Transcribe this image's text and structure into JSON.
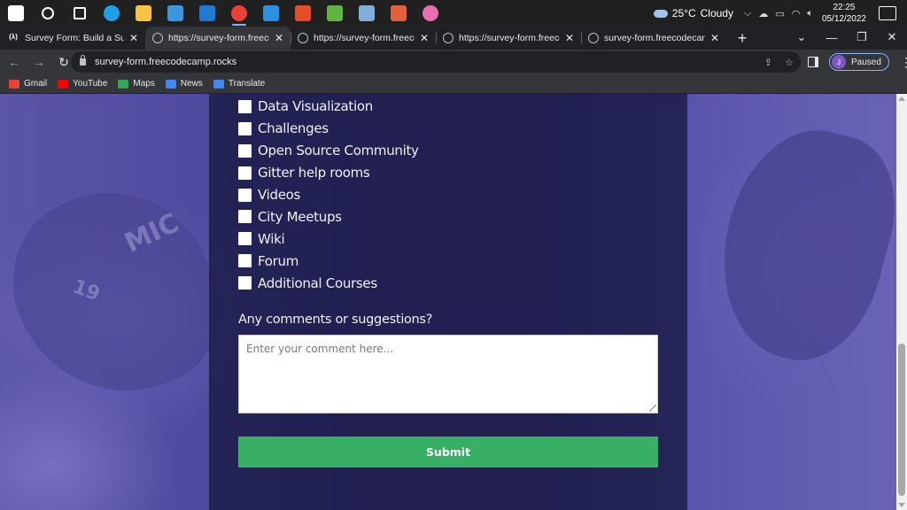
{
  "taskbar": {
    "icons": [
      {
        "name": "windows-start-icon",
        "color": "#ffffff"
      },
      {
        "name": "search-icon",
        "color": "#ffffff"
      },
      {
        "name": "task-view-icon",
        "color": "#ffffff"
      },
      {
        "name": "edge-icon",
        "color": "#1fa0e8"
      },
      {
        "name": "file-explorer-icon",
        "color": "#f6c343"
      },
      {
        "name": "microsoft-store-icon",
        "color": "#3a96dd"
      },
      {
        "name": "mail-icon",
        "color": "#1f7ad6"
      },
      {
        "name": "chrome-icon",
        "color": "#e94235"
      },
      {
        "name": "vscode-icon",
        "color": "#2d8fe0"
      },
      {
        "name": "office-icon",
        "color": "#e44c2a"
      },
      {
        "name": "green-app-icon",
        "color": "#5fb53f"
      },
      {
        "name": "notepad-icon",
        "color": "#7fb0d9"
      },
      {
        "name": "paint-3d-icon",
        "color": "#e2603b"
      },
      {
        "name": "itunes-icon",
        "color": "#e96db0"
      }
    ],
    "weather": {
      "temp": "25°C",
      "condition": "Cloudy"
    },
    "clock": {
      "time": "22:25",
      "date": "05/12/2022"
    }
  },
  "tabs": [
    {
      "title": "Survey Form: Build a Survey F",
      "favicon": "fcc"
    },
    {
      "title": "https://survey-form.freecode",
      "favicon": "globe",
      "active": true
    },
    {
      "title": "https://survey-form.freecode",
      "favicon": "globe"
    },
    {
      "title": "https://survey-form.freecode",
      "favicon": "globe"
    },
    {
      "title": "survey-form.freecodecamp.ro",
      "favicon": "globe"
    }
  ],
  "address_bar": {
    "url": "survey-form.freecodecamp.rocks"
  },
  "profile": {
    "initial": "J",
    "status": "Paused"
  },
  "bookmarks": [
    {
      "label": "Gmail",
      "color": "#ea4335"
    },
    {
      "label": "YouTube",
      "color": "#ff0000"
    },
    {
      "label": "Maps",
      "color": "#34a853"
    },
    {
      "label": "News",
      "color": "#4285f4"
    },
    {
      "label": "Translate",
      "color": "#4285f4"
    }
  ],
  "form": {
    "checkboxes": [
      "Data Visualization",
      "Challenges",
      "Open Source Community",
      "Gitter help rooms",
      "Videos",
      "City Meetups",
      "Wiki",
      "Forum",
      "Additional Courses"
    ],
    "comments_label": "Any comments or suggestions?",
    "comments_placeholder": "Enter your comment here...",
    "submit_label": "Submit",
    "submit_color": "#37af65"
  }
}
